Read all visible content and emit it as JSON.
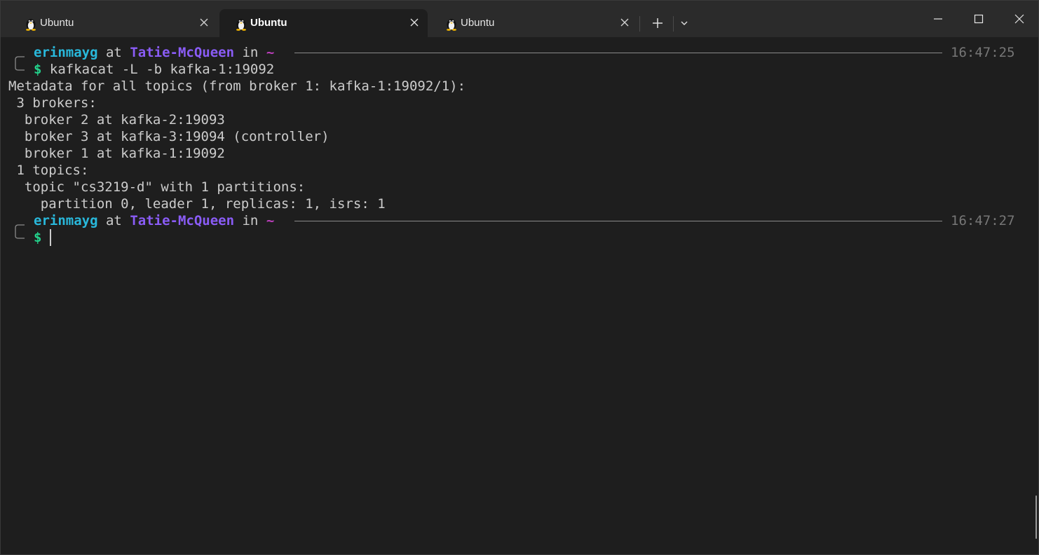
{
  "tabs": [
    {
      "title": "Ubuntu",
      "icon": "tux-icon",
      "active": false
    },
    {
      "title": "Ubuntu",
      "icon": "tux-icon",
      "active": true
    },
    {
      "title": "Ubuntu",
      "icon": "tux-icon",
      "active": false
    }
  ],
  "titlebar": {
    "new_tab_icon": "plus-icon",
    "dropdown_icon": "chevron-down-icon",
    "minimize_icon": "minimize-icon",
    "maximize_icon": "maximize-icon",
    "close_icon": "close-icon"
  },
  "prompt1": {
    "user": "erinmayg",
    "at": "at",
    "host": "Tatie-McQueen",
    "in": "in",
    "dir": "~",
    "time": "16:47:25",
    "symbol": "$",
    "command": "kafkacat -L -b kafka-1:19092"
  },
  "output": [
    "Metadata for all topics (from broker 1: kafka-1:19092/1):",
    " 3 brokers:",
    "  broker 2 at kafka-2:19093",
    "  broker 3 at kafka-3:19094 (controller)",
    "  broker 1 at kafka-1:19092",
    " 1 topics:",
    "  topic \"cs3219-d\" with 1 partitions:",
    "    partition 0, leader 1, replicas: 1, isrs: 1"
  ],
  "prompt2": {
    "user": "erinmayg",
    "at": "at",
    "host": "Tatie-McQueen",
    "in": "in",
    "dir": "~",
    "time": "16:47:27",
    "symbol": "$"
  },
  "colors": {
    "background": "#1e1e1e",
    "tabbar": "#2b2b2b",
    "user": "#29b8db",
    "host": "#8a5cf6",
    "dir": "#bc3fbc",
    "prompt_symbol": "#23d18b",
    "text": "#cccccc",
    "timestamp": "#767676"
  }
}
